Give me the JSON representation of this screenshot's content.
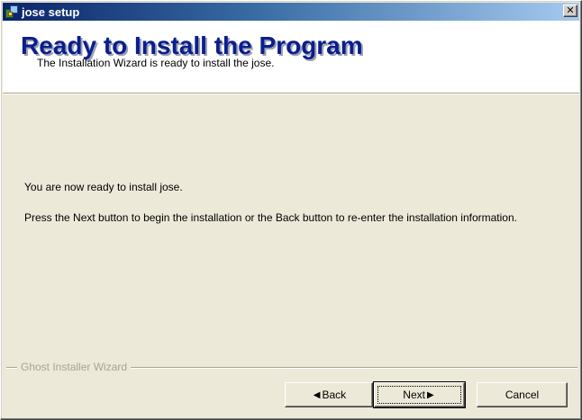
{
  "window": {
    "title": "jose setup",
    "close_glyph": "✕"
  },
  "header": {
    "title": "Ready to Install the Program",
    "subtitle": "The Installation Wizard is ready to install the jose."
  },
  "body": {
    "line1": "You are now ready to install jose.",
    "line2": "Press the Next button to begin the installation or the Back button to re-enter the installation information."
  },
  "footer": {
    "group_label": "Ghost Installer Wizard"
  },
  "buttons": {
    "back_label": "Back",
    "next_label": "Next",
    "cancel_label": "Cancel",
    "back_glyph": "◀",
    "next_glyph": "▶"
  },
  "icons": {
    "app": "setup-app-icon",
    "close": "close-icon",
    "back_arrow": "chevron-left-icon",
    "next_arrow": "chevron-right-icon"
  },
  "colors": {
    "titlebar_start": "#0a246a",
    "titlebar_end": "#a6caf0",
    "header_title": "#0a1e8c",
    "face": "#ece9d8"
  }
}
